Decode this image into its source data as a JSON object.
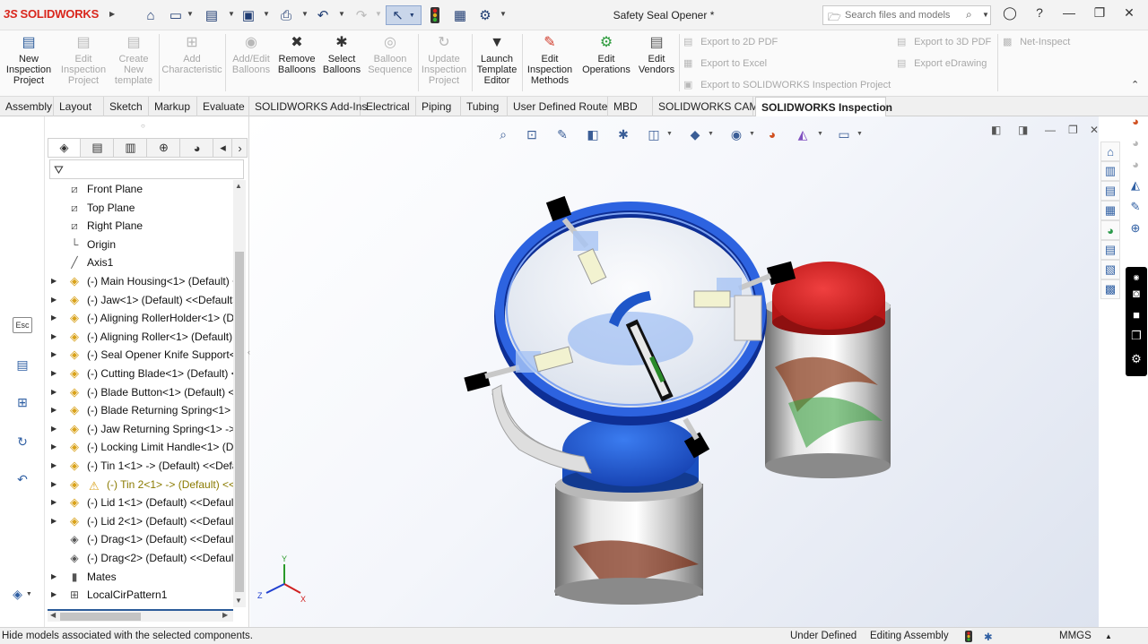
{
  "app": {
    "logo": "SOLIDWORKS",
    "logo_mark": "3S",
    "document_title": "Safety Seal Opener *"
  },
  "search": {
    "placeholder": "Search files and models"
  },
  "ribbon": {
    "buttons": [
      {
        "label": "New Inspection Project",
        "enabled": true
      },
      {
        "label": "Edit Inspection Project",
        "enabled": false
      },
      {
        "label": "Create New template",
        "enabled": false
      },
      {
        "label": "Add Characteristic",
        "enabled": false
      },
      {
        "label": "Add/Edit Balloons",
        "enabled": false
      },
      {
        "label": "Remove Balloons",
        "enabled": true
      },
      {
        "label": "Select Balloons",
        "enabled": true
      },
      {
        "label": "Balloon Sequence",
        "enabled": false
      },
      {
        "label": "Update Inspection Project",
        "enabled": false
      },
      {
        "label": "Launch Template Editor",
        "enabled": true
      },
      {
        "label": "Edit Inspection Methods",
        "enabled": true
      },
      {
        "label": "Edit Operations",
        "enabled": true
      },
      {
        "label": "Edit Vendors",
        "enabled": true
      }
    ],
    "exports": {
      "to_2d_pdf": "Export to 2D PDF",
      "to_excel": "Export to Excel",
      "to_inspection_project": "Export to SOLIDWORKS Inspection Project",
      "to_3d_pdf": "Export to 3D PDF",
      "to_edrawing": "Export eDrawing",
      "net_inspect": "Net-Inspect"
    }
  },
  "tabs": [
    {
      "label": "Assembly",
      "active": false
    },
    {
      "label": "Layout",
      "active": false
    },
    {
      "label": "Sketch",
      "active": false
    },
    {
      "label": "Markup",
      "active": false
    },
    {
      "label": "Evaluate",
      "active": false
    },
    {
      "label": "SOLIDWORKS Add-Ins",
      "active": false
    },
    {
      "label": "Electrical",
      "active": false
    },
    {
      "label": "Piping",
      "active": false
    },
    {
      "label": "Tubing",
      "active": false
    },
    {
      "label": "User Defined Route",
      "active": false
    },
    {
      "label": "MBD",
      "active": false
    },
    {
      "label": "SOLIDWORKS CAM",
      "active": false
    },
    {
      "label": "SOLIDWORKS Inspection",
      "active": true
    }
  ],
  "taskstrip": {
    "esc_label": "Esc"
  },
  "feature_tree": {
    "items": [
      {
        "label": "Front Plane",
        "icon": "plane-icon",
        "expandable": false,
        "warning": false
      },
      {
        "label": "Top Plane",
        "icon": "plane-icon",
        "expandable": false,
        "warning": false
      },
      {
        "label": "Right Plane",
        "icon": "plane-icon",
        "expandable": false,
        "warning": false
      },
      {
        "label": "Origin",
        "icon": "origin-icon",
        "expandable": false,
        "warning": false
      },
      {
        "label": "Axis1",
        "icon": "axis-icon",
        "expandable": false,
        "warning": false
      },
      {
        "label": "(-) Main Housing<1> (Default) <",
        "icon": "component-icon",
        "expandable": true,
        "warning": false
      },
      {
        "label": "(-) Jaw<1> (Default) <<Default>_",
        "icon": "component-icon",
        "expandable": true,
        "warning": false
      },
      {
        "label": "(-) Aligning RollerHolder<1> (De",
        "icon": "component-icon",
        "expandable": true,
        "warning": false
      },
      {
        "label": "(-) Aligning Roller<1> (Default) <",
        "icon": "component-icon",
        "expandable": true,
        "warning": false
      },
      {
        "label": "(-) Seal Opener Knife Support<1>",
        "icon": "component-icon",
        "expandable": true,
        "warning": false
      },
      {
        "label": "(-) Cutting Blade<1> (Default) <<",
        "icon": "component-icon",
        "expandable": true,
        "warning": false
      },
      {
        "label": "(-) Blade Button<1> (Default) <<",
        "icon": "component-icon",
        "expandable": true,
        "warning": false
      },
      {
        "label": "(-) Blade Returning Spring<1> ->",
        "icon": "component-icon",
        "expandable": true,
        "warning": false
      },
      {
        "label": "(-) Jaw Returning Spring<1> -> (I",
        "icon": "component-icon",
        "expandable": true,
        "warning": false
      },
      {
        "label": "(-) Locking Limit Handle<1> (Def",
        "icon": "component-icon",
        "expandable": true,
        "warning": false
      },
      {
        "label": "(-) Tin 1<1> -> (Default) <<Defau",
        "icon": "component-icon",
        "expandable": true,
        "warning": false
      },
      {
        "label": "(-) Tin 2<1> -> (Default) <<I",
        "icon": "component-icon",
        "expandable": true,
        "warning": true
      },
      {
        "label": "(-) Lid 1<1> (Default) <<Default>",
        "icon": "component-icon",
        "expandable": true,
        "warning": false
      },
      {
        "label": "(-) Lid 2<1> (Default) <<Default>",
        "icon": "component-icon",
        "expandable": true,
        "warning": false
      },
      {
        "label": "(-) Drag<1> (Default) <<Default>",
        "icon": "drag-part-icon",
        "expandable": false,
        "warning": false
      },
      {
        "label": "(-) Drag<2> (Default) <<Default>",
        "icon": "drag-part-icon",
        "expandable": false,
        "warning": false
      },
      {
        "label": "Mates",
        "icon": "mates-icon",
        "expandable": true,
        "warning": false
      },
      {
        "label": "LocalCirPattern1",
        "icon": "pattern-icon",
        "expandable": true,
        "warning": false
      }
    ]
  },
  "triad": {
    "x": "X",
    "y": "Y",
    "z": "Z"
  },
  "colors": {
    "accent_blue": "#2c5c9a",
    "brand_red": "#d9261c",
    "lid_blue": "#1e56c9",
    "lid_red": "#d91a1a"
  },
  "status": {
    "message": "Hide models associated with the selected components.",
    "definition": "Under Defined",
    "mode": "Editing Assembly",
    "units": "MMGS"
  }
}
